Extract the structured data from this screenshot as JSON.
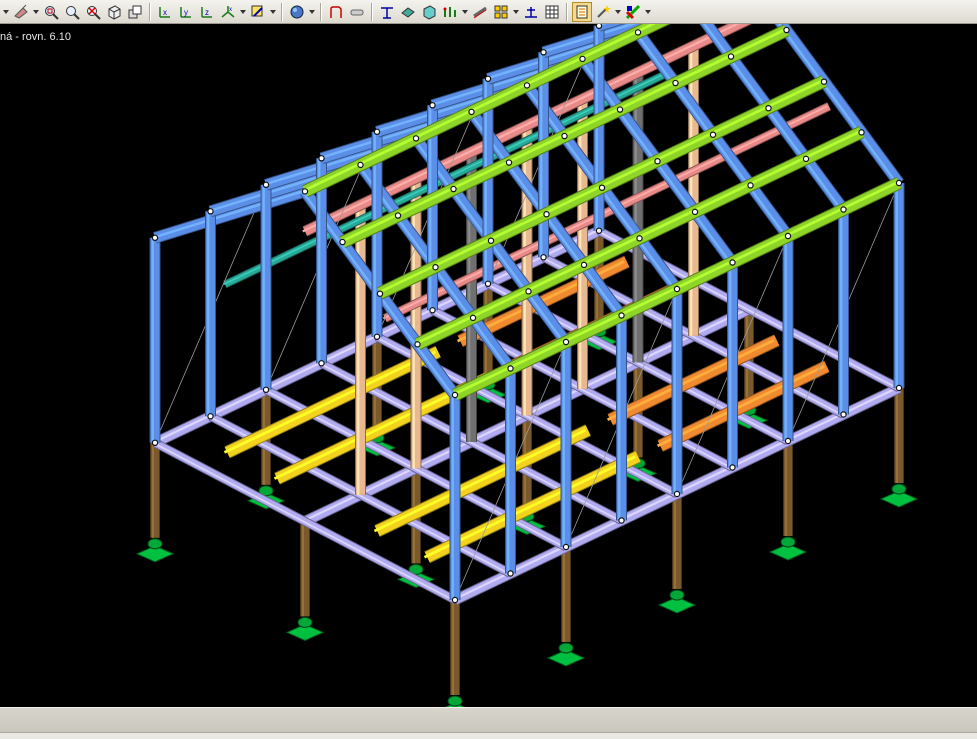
{
  "window": {
    "view_title": "ná - rovn. 6.10"
  },
  "toolbar": {
    "buttons": [
      {
        "name": "pipe-icon",
        "dropdown": true
      },
      {
        "name": "zoom-window-icon"
      },
      {
        "name": "zoom-icon"
      },
      {
        "name": "zoom-cancel-icon"
      },
      {
        "name": "view-box-icon"
      },
      {
        "name": "view-multi-icon"
      },
      {
        "sep": true
      },
      {
        "name": "view-x-icon"
      },
      {
        "name": "view-y-icon"
      },
      {
        "name": "view-z-icon"
      },
      {
        "name": "view-xyz-icon",
        "dropdown": true
      },
      {
        "name": "render-options-icon",
        "dropdown": true
      },
      {
        "sep": true
      },
      {
        "name": "shading-icon",
        "dropdown": true
      },
      {
        "sep": true
      },
      {
        "name": "frame-icon"
      },
      {
        "name": "section-icon"
      },
      {
        "sep": true
      },
      {
        "name": "measure-icon"
      },
      {
        "name": "surface-icon"
      },
      {
        "name": "solid-icon"
      },
      {
        "name": "members-icon",
        "dropdown": true
      },
      {
        "name": "ruler-icon"
      },
      {
        "name": "grid-icon",
        "dropdown": true
      },
      {
        "name": "dimension-icon"
      },
      {
        "name": "table-icon"
      },
      {
        "sep": true
      },
      {
        "name": "layers-icon",
        "active": true
      },
      {
        "name": "magic-wand-icon",
        "dropdown": true
      },
      {
        "name": "colors-icon",
        "dropdown": true
      }
    ]
  },
  "statusbar": {
    "text": ""
  },
  "colors": {
    "background": "#000000",
    "column": "#5b8ee6",
    "purlin": "#8fd428",
    "floor_beam": "#b0aaf0",
    "joist": "#f2d21f",
    "pier": "#7a5a2c",
    "support": "#00c040",
    "inner_column": "#e8b890",
    "inner_beam": "#e88a88",
    "orange_beam": "#f08a30",
    "teal_beam": "#2aa898",
    "gray_column": "#707070"
  }
}
